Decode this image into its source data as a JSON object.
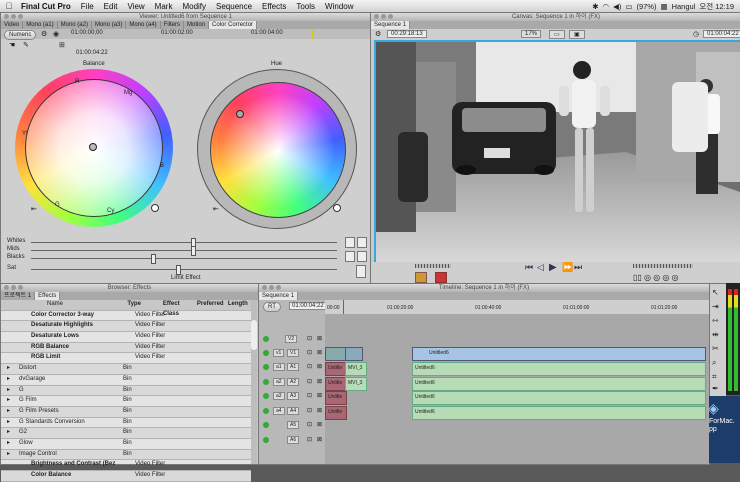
{
  "menubar": {
    "app": "Final Cut Pro",
    "items": [
      "File",
      "Edit",
      "View",
      "Mark",
      "Modify",
      "Sequence",
      "Effects",
      "Tools",
      "Window"
    ],
    "battery": "(97%)",
    "input": "Hangul",
    "clock": "오전 12:19"
  },
  "viewer": {
    "title": "Viewer: Untitled6 from Sequence 1",
    "tabs": [
      "Video",
      "Mono (a1)",
      "Mono (a2)",
      "Mono (a3)",
      "Mono (a4)",
      "Filters",
      "Motion",
      "Color Corrector"
    ],
    "timecode_left": "01:00:00;00",
    "timecode_mid": "01:00:02:00",
    "timecode_right": "01:00:04:00",
    "numeric_button": "Numeric",
    "duration": "01:00:04:22",
    "balance_label": "Balance",
    "hue_label": "Hue",
    "wheel_marks": {
      "r": "R",
      "mg": "Mg",
      "yl": "Yl",
      "b": "B",
      "g": "G",
      "cy": "Cy"
    },
    "sliders": [
      {
        "label": "Whites",
        "value": 0.53
      },
      {
        "label": "Mids",
        "value": 0.53
      },
      {
        "label": "Blacks",
        "value": 0.4
      },
      {
        "label": "Sat",
        "value": 0.48
      }
    ],
    "limit_effect": "Limit Effect"
  },
  "canvas": {
    "title": "Canvas: Sequence 1 in 하이 (FX)",
    "tab": "Sequence 1",
    "timecode_left": "00:29:18:13",
    "zoom": "17%",
    "timecode_right": "01:00:04:22"
  },
  "browser": {
    "title": "Browser: Effects",
    "tabs": [
      "프로젝트 1",
      "Effects"
    ],
    "columns": [
      "Name",
      "Type",
      "Effect Class",
      "Preferred",
      "Length"
    ],
    "rows": [
      {
        "name": "Color Corrector 3-way",
        "type": "Video Filter",
        "level": 2
      },
      {
        "name": "Desaturate Highlights",
        "type": "Video Filter",
        "level": 2
      },
      {
        "name": "Desaturate Lows",
        "type": "Video Filter",
        "level": 2
      },
      {
        "name": "RGB Balance",
        "type": "Video Filter",
        "level": 2
      },
      {
        "name": "RGB Limit",
        "type": "Video Filter",
        "level": 2
      },
      {
        "name": "Distort",
        "type": "Bin",
        "level": 1
      },
      {
        "name": "dvGarage",
        "type": "Bin",
        "level": 1
      },
      {
        "name": "G",
        "type": "Bin",
        "level": 1
      },
      {
        "name": "G Film",
        "type": "Bin",
        "level": 1
      },
      {
        "name": "G Film Presets",
        "type": "Bin",
        "level": 1
      },
      {
        "name": "G Standards Conversion",
        "type": "Bin",
        "level": 1
      },
      {
        "name": "G2",
        "type": "Bin",
        "level": 1
      },
      {
        "name": "Glow",
        "type": "Bin",
        "level": 1
      },
      {
        "name": "Image Control",
        "type": "Bin",
        "level": 1
      },
      {
        "name": "Brightness and Contrast (Bez",
        "type": "Video Filter",
        "level": 2
      },
      {
        "name": "Color Balance",
        "type": "Video Filter",
        "level": 2
      }
    ]
  },
  "timeline": {
    "title": "Timeline: Sequence 1 in 하이 (FX)",
    "tab": "Sequence 1",
    "rt": "RT",
    "timecode": "01:00:04:22",
    "ruler": [
      "00:00",
      "01:00:20:00",
      "01:00:40:00",
      "01:01:00:00",
      "01:01:20:00"
    ],
    "video_tracks": [
      "V2",
      "V1"
    ],
    "audio_tracks": [
      "A1",
      "A2",
      "A3",
      "A4",
      "A5",
      "A6"
    ],
    "src_v": "v1",
    "src_a": [
      "a1",
      "a2",
      "a3",
      "a4"
    ],
    "clip_label": "Untitled6",
    "small_clip": "MVI_3",
    "tr_clip": "Untitle"
  },
  "desktop": {
    "label1": "ForMac.",
    "label2": "pp"
  }
}
